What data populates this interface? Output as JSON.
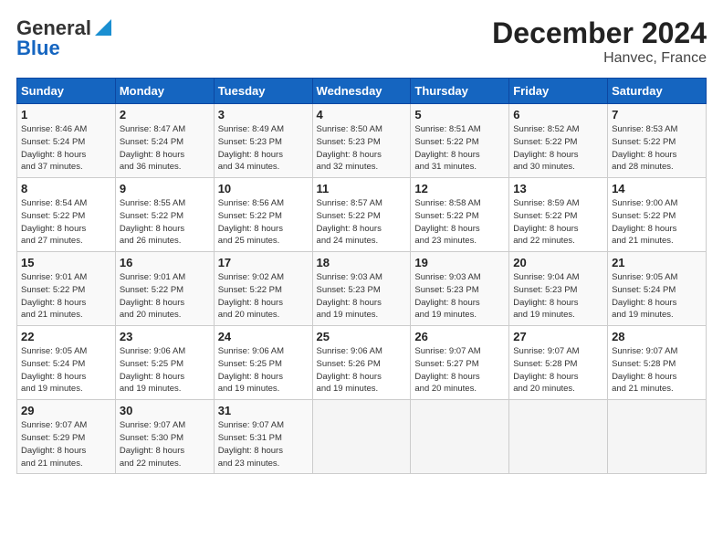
{
  "logo": {
    "line1": "General",
    "line2": "Blue"
  },
  "title": "December 2024",
  "subtitle": "Hanvec, France",
  "days_header": [
    "Sunday",
    "Monday",
    "Tuesday",
    "Wednesday",
    "Thursday",
    "Friday",
    "Saturday"
  ],
  "weeks": [
    [
      {
        "day": "1",
        "info": "Sunrise: 8:46 AM\nSunset: 5:24 PM\nDaylight: 8 hours\nand 37 minutes."
      },
      {
        "day": "2",
        "info": "Sunrise: 8:47 AM\nSunset: 5:24 PM\nDaylight: 8 hours\nand 36 minutes."
      },
      {
        "day": "3",
        "info": "Sunrise: 8:49 AM\nSunset: 5:23 PM\nDaylight: 8 hours\nand 34 minutes."
      },
      {
        "day": "4",
        "info": "Sunrise: 8:50 AM\nSunset: 5:23 PM\nDaylight: 8 hours\nand 32 minutes."
      },
      {
        "day": "5",
        "info": "Sunrise: 8:51 AM\nSunset: 5:22 PM\nDaylight: 8 hours\nand 31 minutes."
      },
      {
        "day": "6",
        "info": "Sunrise: 8:52 AM\nSunset: 5:22 PM\nDaylight: 8 hours\nand 30 minutes."
      },
      {
        "day": "7",
        "info": "Sunrise: 8:53 AM\nSunset: 5:22 PM\nDaylight: 8 hours\nand 28 minutes."
      }
    ],
    [
      {
        "day": "8",
        "info": "Sunrise: 8:54 AM\nSunset: 5:22 PM\nDaylight: 8 hours\nand 27 minutes."
      },
      {
        "day": "9",
        "info": "Sunrise: 8:55 AM\nSunset: 5:22 PM\nDaylight: 8 hours\nand 26 minutes."
      },
      {
        "day": "10",
        "info": "Sunrise: 8:56 AM\nSunset: 5:22 PM\nDaylight: 8 hours\nand 25 minutes."
      },
      {
        "day": "11",
        "info": "Sunrise: 8:57 AM\nSunset: 5:22 PM\nDaylight: 8 hours\nand 24 minutes."
      },
      {
        "day": "12",
        "info": "Sunrise: 8:58 AM\nSunset: 5:22 PM\nDaylight: 8 hours\nand 23 minutes."
      },
      {
        "day": "13",
        "info": "Sunrise: 8:59 AM\nSunset: 5:22 PM\nDaylight: 8 hours\nand 22 minutes."
      },
      {
        "day": "14",
        "info": "Sunrise: 9:00 AM\nSunset: 5:22 PM\nDaylight: 8 hours\nand 21 minutes."
      }
    ],
    [
      {
        "day": "15",
        "info": "Sunrise: 9:01 AM\nSunset: 5:22 PM\nDaylight: 8 hours\nand 21 minutes."
      },
      {
        "day": "16",
        "info": "Sunrise: 9:01 AM\nSunset: 5:22 PM\nDaylight: 8 hours\nand 20 minutes."
      },
      {
        "day": "17",
        "info": "Sunrise: 9:02 AM\nSunset: 5:22 PM\nDaylight: 8 hours\nand 20 minutes."
      },
      {
        "day": "18",
        "info": "Sunrise: 9:03 AM\nSunset: 5:23 PM\nDaylight: 8 hours\nand 19 minutes."
      },
      {
        "day": "19",
        "info": "Sunrise: 9:03 AM\nSunset: 5:23 PM\nDaylight: 8 hours\nand 19 minutes."
      },
      {
        "day": "20",
        "info": "Sunrise: 9:04 AM\nSunset: 5:23 PM\nDaylight: 8 hours\nand 19 minutes."
      },
      {
        "day": "21",
        "info": "Sunrise: 9:05 AM\nSunset: 5:24 PM\nDaylight: 8 hours\nand 19 minutes."
      }
    ],
    [
      {
        "day": "22",
        "info": "Sunrise: 9:05 AM\nSunset: 5:24 PM\nDaylight: 8 hours\nand 19 minutes."
      },
      {
        "day": "23",
        "info": "Sunrise: 9:06 AM\nSunset: 5:25 PM\nDaylight: 8 hours\nand 19 minutes."
      },
      {
        "day": "24",
        "info": "Sunrise: 9:06 AM\nSunset: 5:25 PM\nDaylight: 8 hours\nand 19 minutes."
      },
      {
        "day": "25",
        "info": "Sunrise: 9:06 AM\nSunset: 5:26 PM\nDaylight: 8 hours\nand 19 minutes."
      },
      {
        "day": "26",
        "info": "Sunrise: 9:07 AM\nSunset: 5:27 PM\nDaylight: 8 hours\nand 20 minutes."
      },
      {
        "day": "27",
        "info": "Sunrise: 9:07 AM\nSunset: 5:28 PM\nDaylight: 8 hours\nand 20 minutes."
      },
      {
        "day": "28",
        "info": "Sunrise: 9:07 AM\nSunset: 5:28 PM\nDaylight: 8 hours\nand 21 minutes."
      }
    ],
    [
      {
        "day": "29",
        "info": "Sunrise: 9:07 AM\nSunset: 5:29 PM\nDaylight: 8 hours\nand 21 minutes."
      },
      {
        "day": "30",
        "info": "Sunrise: 9:07 AM\nSunset: 5:30 PM\nDaylight: 8 hours\nand 22 minutes."
      },
      {
        "day": "31",
        "info": "Sunrise: 9:07 AM\nSunset: 5:31 PM\nDaylight: 8 hours\nand 23 minutes."
      },
      {
        "day": "",
        "info": ""
      },
      {
        "day": "",
        "info": ""
      },
      {
        "day": "",
        "info": ""
      },
      {
        "day": "",
        "info": ""
      }
    ]
  ]
}
